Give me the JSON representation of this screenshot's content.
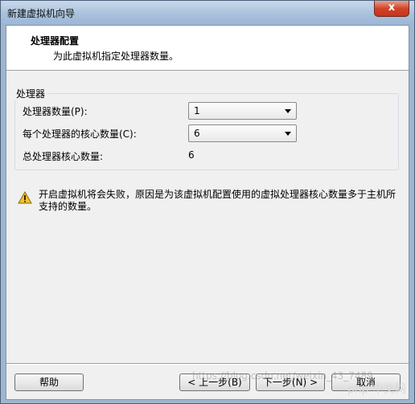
{
  "window": {
    "title": "新建虚拟机向导",
    "close_label": "x"
  },
  "header": {
    "title": "处理器配置",
    "subtitle": "为此虚拟机指定处理器数量。"
  },
  "processor_group": {
    "label": "处理器",
    "processor_count_label": "处理器数量(P):",
    "processor_count_value": "1",
    "cores_per_processor_label": "每个处理器的核心数量(C):",
    "cores_per_processor_value": "6",
    "total_cores_label": "总处理器核心数量:",
    "total_cores_value": "6"
  },
  "warning": {
    "icon": "warning-icon",
    "text": "开启虚拟机将会失败，原因是为该虚拟机配置使用的虚拟处理器核心数量多于主机所支持的数量。"
  },
  "footer": {
    "help_label": "帮助",
    "back_label": "< 上一步(B)",
    "next_label": "下一步(N) >",
    "cancel_label": "取消"
  },
  "overlay": {
    "watermark_text": "https://blog.csdn.net/weixin_43_7489",
    "logo_text": "php 中文网"
  },
  "colors": {
    "title_bar": "#a9c1dc",
    "close_button": "#d1442a",
    "dialog_bg": "#f0f0f0",
    "warning_yellow": "#f2c230"
  }
}
